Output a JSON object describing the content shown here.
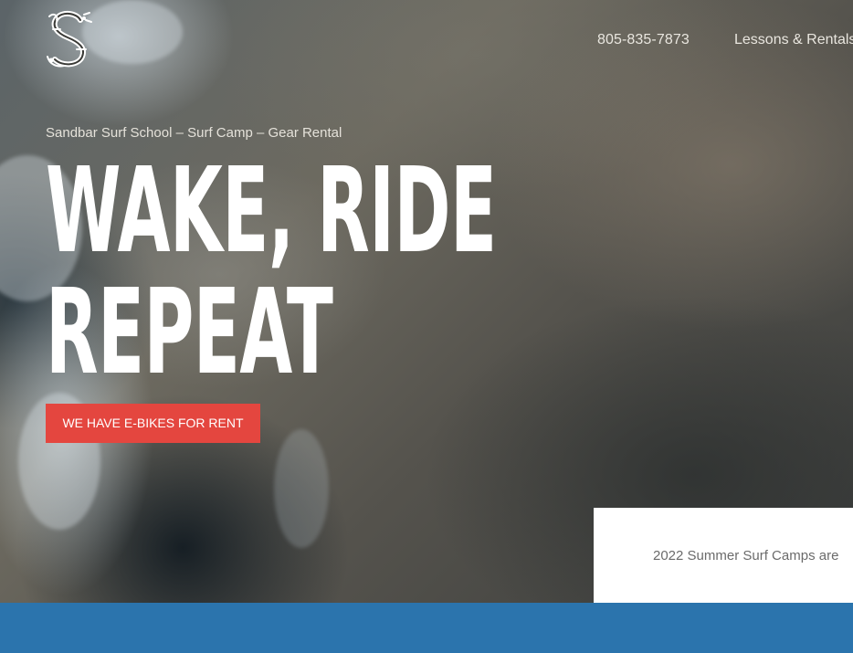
{
  "header": {
    "logo_icon": "sandbar-s-monogram-icon",
    "nav": {
      "phone": "805-835-7873",
      "lessons": "Lessons & Rentals"
    }
  },
  "hero": {
    "subtitle": "Sandbar Surf School – Surf Camp – Gear Rental",
    "headline_line1": "WAKE, RIDE",
    "headline_line2": "REPEAT",
    "cta_label": "WE HAVE E-BIKES FOR RENT"
  },
  "notice": {
    "text": "2022 Summer Surf Camps are"
  },
  "colors": {
    "cta": "#e4463f",
    "bottom_bar": "#2b74ad",
    "notice_bg": "#ffffff"
  }
}
